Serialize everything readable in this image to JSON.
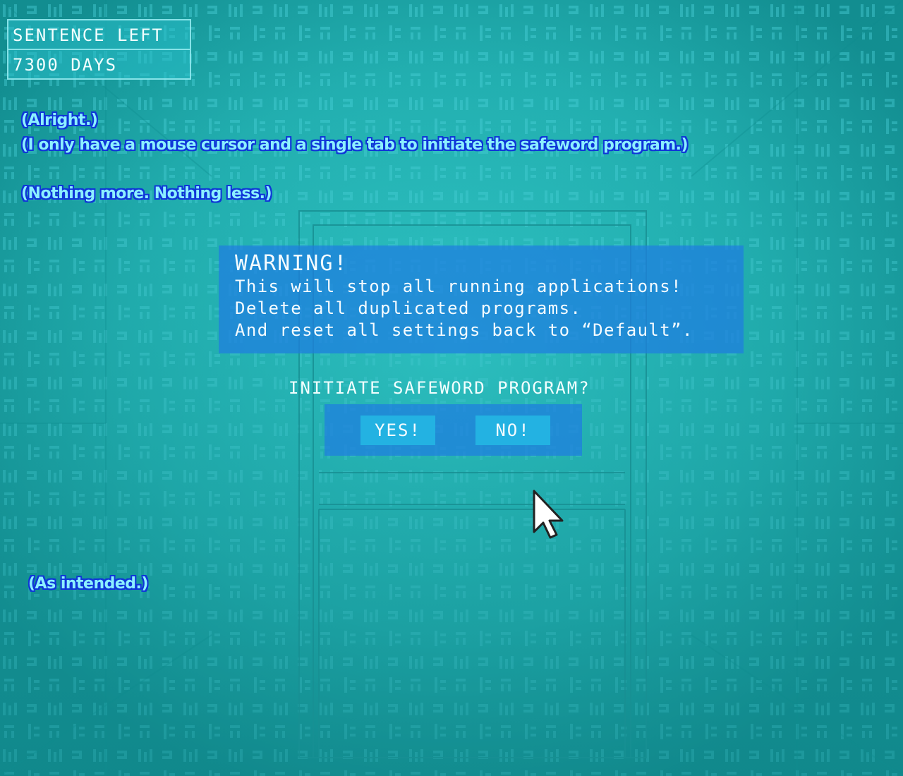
{
  "hud": {
    "label": "SENTENCE LEFT",
    "value": "7300 DAYS"
  },
  "monologue": {
    "line1": "(Alright.)",
    "line2": "(I only have a mouse cursor and a single tab to initiate the safeword program.)",
    "line3": "(Nothing more. Nothing less.)",
    "line4": "(As intended.)"
  },
  "dialog": {
    "title": "WARNING!",
    "lines": [
      "This will stop all running applications!",
      "Delete all duplicated programs.",
      "And reset all settings back to “Default”."
    ],
    "prompt": "INITIATE SAFEWORD PROGRAM?",
    "yes_label": "YES!",
    "no_label": "NO!"
  },
  "colors": {
    "background": "#1fa8a8",
    "dialog": "#1e7de1",
    "button": "#23b2e2",
    "monologue_text": "#8cf0ff",
    "monologue_outline": "#0f35d8"
  },
  "icons": {
    "cursor": "mouse-pointer-icon"
  }
}
